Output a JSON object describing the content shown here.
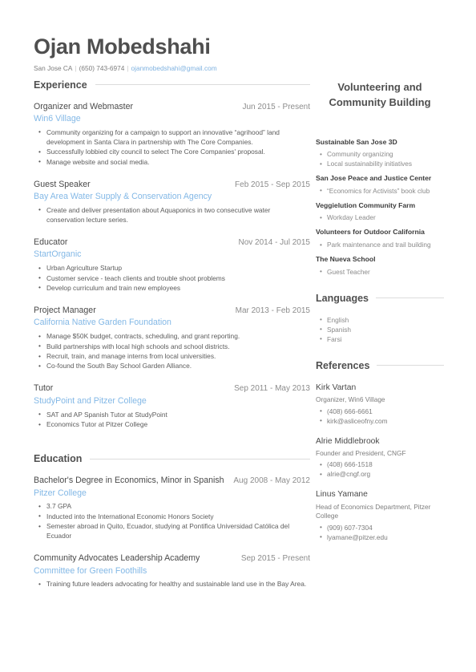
{
  "colors": {
    "accent_link": "#83b8e6",
    "heading": "#4f4f4f",
    "body_text": "#5c5c5c",
    "muted": "#8c8c8c",
    "rule": "#dcdcdc"
  },
  "header": {
    "name": "Ojan Mobedshahi",
    "location": "San Jose CA",
    "phone": "(650) 743-6974",
    "email": "ojanmobedshahi@gmail.com",
    "separator": "|"
  },
  "main": {
    "sections": [
      {
        "heading": "Experience",
        "entries": [
          {
            "title": "Organizer and Webmaster",
            "date": "Jun 2015 - Present",
            "org": "Win6 Village",
            "bullets": [
              "Community organizing for a campaign to support an innovative “agrihood” land development in Santa Clara in partnership with The Core Companies.",
              "Successfully lobbied city council to select The Core Companies' proposal.",
              "Manage website and social media."
            ]
          },
          {
            "title": "Guest Speaker",
            "date": "Feb 2015 - Sep 2015",
            "org": "Bay Area Water Supply & Conservation Agency",
            "bullets": [
              "Create and deliver presentation about Aquaponics in two consecutive water conservation lecture series."
            ]
          },
          {
            "title": "Educator",
            "date": "Nov 2014 - Jul 2015",
            "org": "StartOrganic",
            "bullets": [
              "Urban Agriculture Startup",
              "Customer service - teach clients and trouble shoot problems",
              "Develop curriculum and train new employees"
            ]
          },
          {
            "title": "Project Manager",
            "date": "Mar 2013 - Feb 2015",
            "org": "California Native Garden Foundation",
            "bullets": [
              "Manage $50K budget, contracts, scheduling, and grant reporting.",
              "Build partnerships with local high schools and school districts.",
              "Recruit,  train, and manage interns from local universities.",
              "Co-found the South Bay School Garden Alliance."
            ]
          },
          {
            "title": "Tutor",
            "date": "Sep 2011 - May 2013",
            "org": "StudyPoint and Pitzer College",
            "bullets": [
              "SAT and AP Spanish Tutor at StudyPoint",
              "Economics Tutor at Pitzer College"
            ]
          }
        ]
      },
      {
        "heading": "Education",
        "entries": [
          {
            "title": "Bachelor's Degree in Economics,  Minor in Spanish",
            "date": "Aug 2008 - May 2012",
            "org": "Pitzer College",
            "bullets": [
              "3.7 GPA",
              "Inducted into the International Economic Honors Society",
              "Semester abroad in Quito, Ecuador, studying at Pontifica Universidad Católica del Ecuador"
            ]
          },
          {
            "title": "Community Advocates Leadership Academy",
            "date": "Sep 2015 - Present",
            "org": "Committee for Green Foothills",
            "bullets": [
              "Training future leaders advocating for healthy and sustainable land use in the Bay Area."
            ]
          }
        ]
      }
    ]
  },
  "sidebar": {
    "title": "Volunteering and Community Building",
    "volunteering": [
      {
        "name": "Sustainable San Jose 3D",
        "bullets": [
          "Community organizing",
          "Local sustainability initiatives"
        ]
      },
      {
        "name": "San Jose Peace and Justice Center",
        "bullets": [
          "“Economics for Activists” book club"
        ]
      },
      {
        "name": "Veggielution Community Farm",
        "bullets": [
          "Workday Leader"
        ]
      },
      {
        "name": "Volunteers for Outdoor California",
        "bullets": [
          "Park maintenance and trail building"
        ]
      },
      {
        "name": "The Nueva School",
        "bullets": [
          "Guest Teacher"
        ]
      }
    ],
    "languages": {
      "heading": "Languages",
      "items": [
        "English",
        "Spanish",
        "Farsi"
      ]
    },
    "references": {
      "heading": "References",
      "items": [
        {
          "name": "Kirk Vartan",
          "role": "Organizer, Win6 Village",
          "contacts": [
            "(408) 666-6661",
            "kirk@asliceofny.com"
          ]
        },
        {
          "name": "Alrie Middlebrook",
          "role": "Founder and President, CNGF",
          "contacts": [
            "(408) 666-1518",
            "alrie@cngf.org"
          ]
        },
        {
          "name": "Linus Yamane",
          "role": "Head of Economics Department, Pitzer College",
          "contacts": [
            "(909) 607-7304",
            "lyamane@pitzer.edu"
          ]
        }
      ]
    }
  }
}
